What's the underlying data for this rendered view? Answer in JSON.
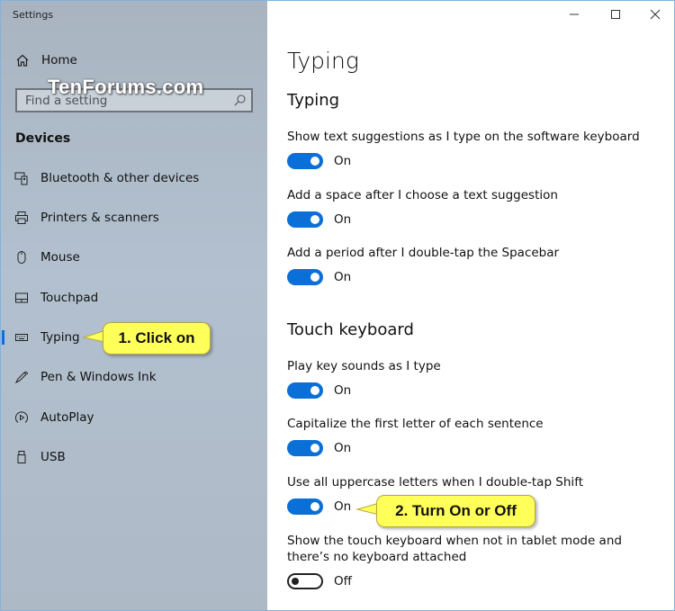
{
  "window": {
    "title": "Settings",
    "controls": {
      "minimize_icon": "minimize-icon",
      "maximize_icon": "maximize-icon",
      "close_icon": "close-icon"
    }
  },
  "sidebar": {
    "home_label": "Home",
    "search_placeholder": "Find a setting",
    "section_title": "Devices",
    "items": [
      {
        "label": "Bluetooth & other devices",
        "icon": "bluetooth-devices-icon",
        "selected": false
      },
      {
        "label": "Printers & scanners",
        "icon": "printer-icon",
        "selected": false
      },
      {
        "label": "Mouse",
        "icon": "mouse-icon",
        "selected": false
      },
      {
        "label": "Touchpad",
        "icon": "touchpad-icon",
        "selected": false
      },
      {
        "label": "Typing",
        "icon": "keyboard-icon",
        "selected": true
      },
      {
        "label": "Pen & Windows Ink",
        "icon": "pen-icon",
        "selected": false
      },
      {
        "label": "AutoPlay",
        "icon": "autoplay-icon",
        "selected": false
      },
      {
        "label": "USB",
        "icon": "usb-icon",
        "selected": false
      }
    ]
  },
  "watermark": "TenForums.com",
  "main": {
    "page_title": "Typing",
    "groups": [
      {
        "title": "Typing",
        "settings": [
          {
            "label": "Show text suggestions as I type on the software keyboard",
            "state": "On",
            "on": true
          },
          {
            "label": "Add a space after I choose a text suggestion",
            "state": "On",
            "on": true
          },
          {
            "label": "Add a period after I double-tap the Spacebar",
            "state": "On",
            "on": true
          }
        ]
      },
      {
        "title": "Touch keyboard",
        "settings": [
          {
            "label": "Play key sounds as I type",
            "state": "On",
            "on": true
          },
          {
            "label": "Capitalize the first letter of each sentence",
            "state": "On",
            "on": true
          },
          {
            "label": "Use all uppercase letters when I double-tap Shift",
            "state": "On",
            "on": true
          },
          {
            "label": "Show the touch keyboard when not in tablet mode and there’s no keyboard attached",
            "state": "Off",
            "on": false
          }
        ]
      }
    ]
  },
  "callouts": {
    "step1": "1. Click on",
    "step2": "2. Turn On or Off"
  },
  "colors": {
    "accent": "#0a6fd6",
    "callout_fill": "#ffff5a"
  }
}
